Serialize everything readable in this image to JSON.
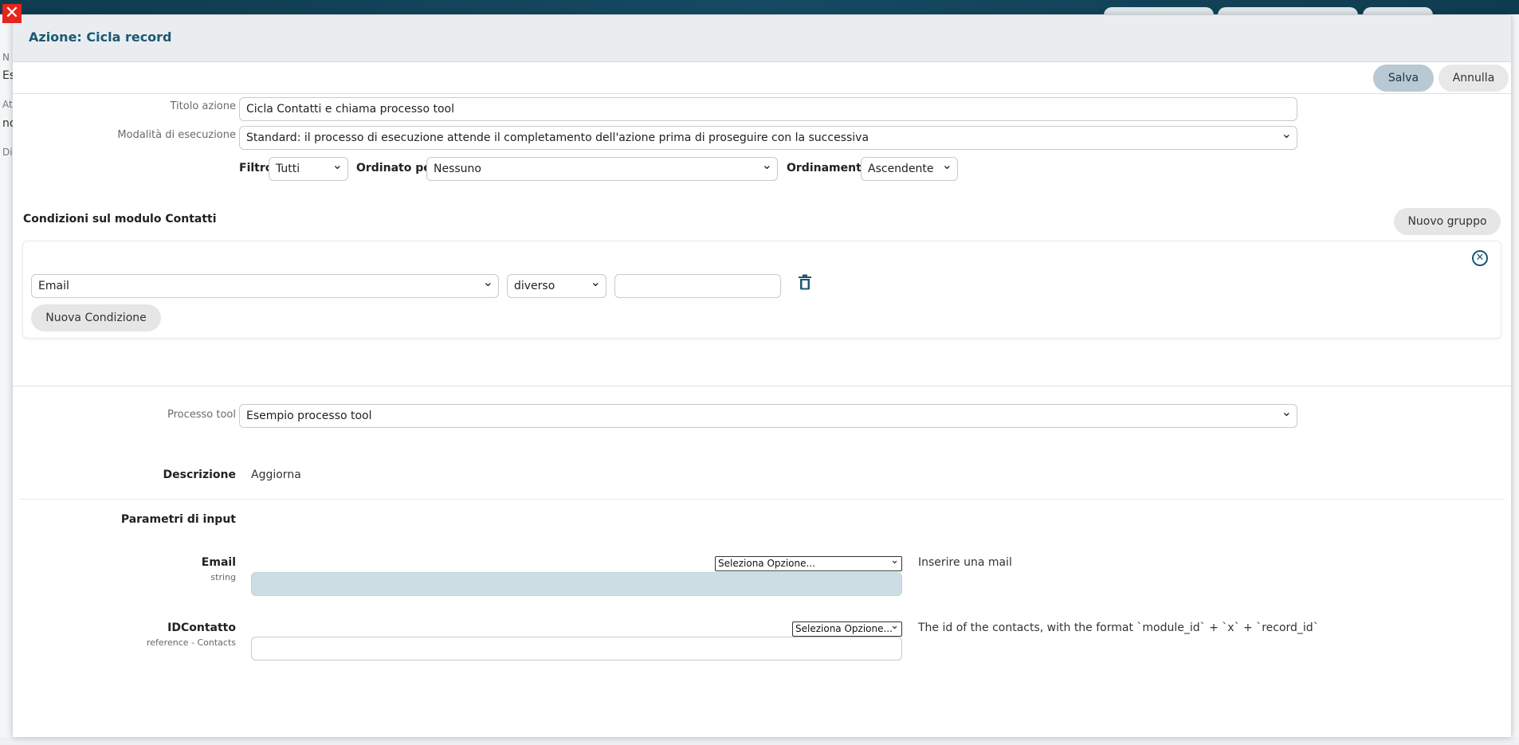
{
  "background": {
    "sidebar_fragments": [
      "N",
      "Es",
      "At",
      "no",
      "Di"
    ]
  },
  "modal": {
    "title": "Azione: Cicla record",
    "save_label": "Salva",
    "cancel_label": "Annulla"
  },
  "form": {
    "action_title_label": "Titolo azione",
    "action_title_value": "Cicla Contatti e chiama processo tool",
    "exec_mode_label": "Modalità di esecuzione",
    "exec_mode_value": "Standard: il processo di esecuzione attende il completamento dell'azione prima di proseguire con la successiva",
    "filter_label": "Filtro",
    "filter_value": "Tutti",
    "ordered_by_label": "Ordinato per",
    "ordered_by_value": "Nessuno",
    "ordering_label": "Ordinamento",
    "ordering_value": "Ascendente"
  },
  "conditions": {
    "title": "Condizioni sul modulo Contatti",
    "new_group_label": "Nuovo gruppo",
    "field_value": "Email",
    "operator_value": "diverso",
    "value_input": "",
    "new_condition_label": "Nuova Condizione"
  },
  "tool": {
    "process_label": "Processo tool",
    "process_value": "Esempio processo tool",
    "description_label": "Descrizione",
    "description_value": "Aggiorna",
    "input_params_label": "Parametri di input"
  },
  "params": [
    {
      "name": "Email",
      "type": "string",
      "option_select": "Seleziona Opzione...",
      "description": "Inserire una mail"
    },
    {
      "name": "IDContatto",
      "type": "reference - Contacts",
      "option_select": "Seleziona Opzione...",
      "description": "The id of the contacts, with the format `module_id` + `x` + `record_id`"
    }
  ],
  "colors": {
    "accent": "#1c5873",
    "close_red": "#e4261d",
    "save_button": "#b8c9d3",
    "filled_input": "#ccdde4"
  }
}
